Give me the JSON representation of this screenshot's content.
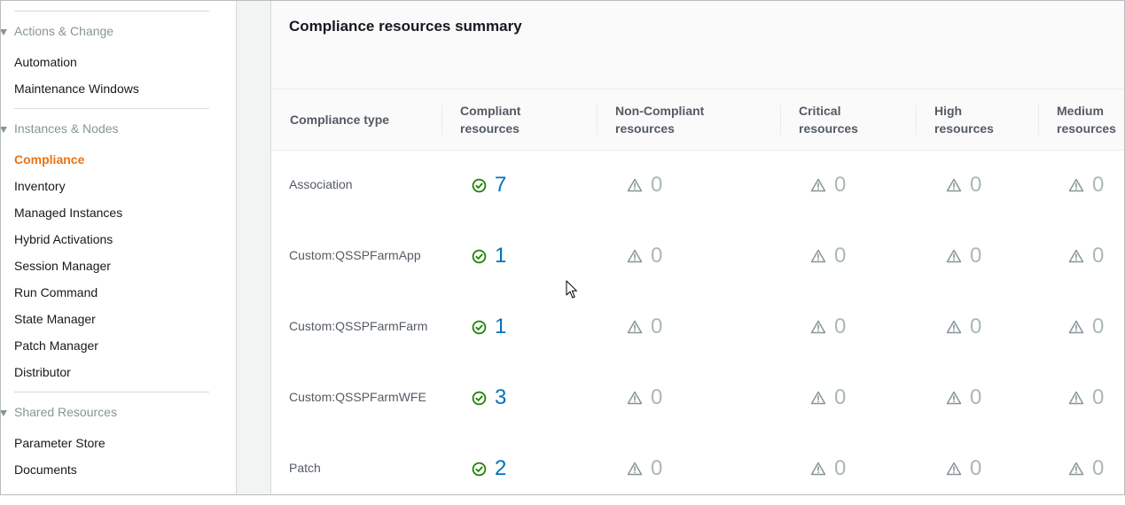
{
  "sidebar": {
    "sections": [
      {
        "title": "Actions & Change",
        "items": [
          "Automation",
          "Maintenance Windows"
        ]
      },
      {
        "title": "Instances & Nodes",
        "items": [
          "Compliance",
          "Inventory",
          "Managed Instances",
          "Hybrid Activations",
          "Session Manager",
          "Run Command",
          "State Manager",
          "Patch Manager",
          "Distributor"
        ]
      },
      {
        "title": "Shared Resources",
        "items": [
          "Parameter Store",
          "Documents"
        ]
      }
    ],
    "active_item": "Compliance"
  },
  "panel": {
    "title": "Compliance resources summary",
    "columns": [
      {
        "line1": "Compliance type",
        "line2": ""
      },
      {
        "line1": "Compliant",
        "line2": "resources"
      },
      {
        "line1": "Non-Compliant",
        "line2": "resources"
      },
      {
        "line1": "Critical",
        "line2": "resources"
      },
      {
        "line1": "High",
        "line2": "resources"
      },
      {
        "line1": "Medium",
        "line2": "resources"
      }
    ],
    "rows": [
      {
        "type": "Association",
        "compliant": "7",
        "non_compliant": "0",
        "critical": "0",
        "high": "0",
        "medium": "0"
      },
      {
        "type": "Custom:QSSPFarmApp",
        "compliant": "1",
        "non_compliant": "0",
        "critical": "0",
        "high": "0",
        "medium": "0"
      },
      {
        "type": "Custom:QSSPFarmFarm",
        "compliant": "1",
        "non_compliant": "0",
        "critical": "0",
        "high": "0",
        "medium": "0"
      },
      {
        "type": "Custom:QSSPFarmWFE",
        "compliant": "3",
        "non_compliant": "0",
        "critical": "0",
        "high": "0",
        "medium": "0"
      },
      {
        "type": "Patch",
        "compliant": "2",
        "non_compliant": "0",
        "critical": "0",
        "high": "0",
        "medium": "0"
      }
    ]
  },
  "icons": {
    "section_caret": "caret-down-icon",
    "compliant": "check-circle-icon",
    "warning": "warning-triangle-icon",
    "pointer": "mouse-pointer-icon"
  },
  "colors": {
    "active_nav": "#ec7211",
    "compliant_icon": "#1d8102",
    "link": "#0073bb",
    "muted": "#aab7b8"
  }
}
